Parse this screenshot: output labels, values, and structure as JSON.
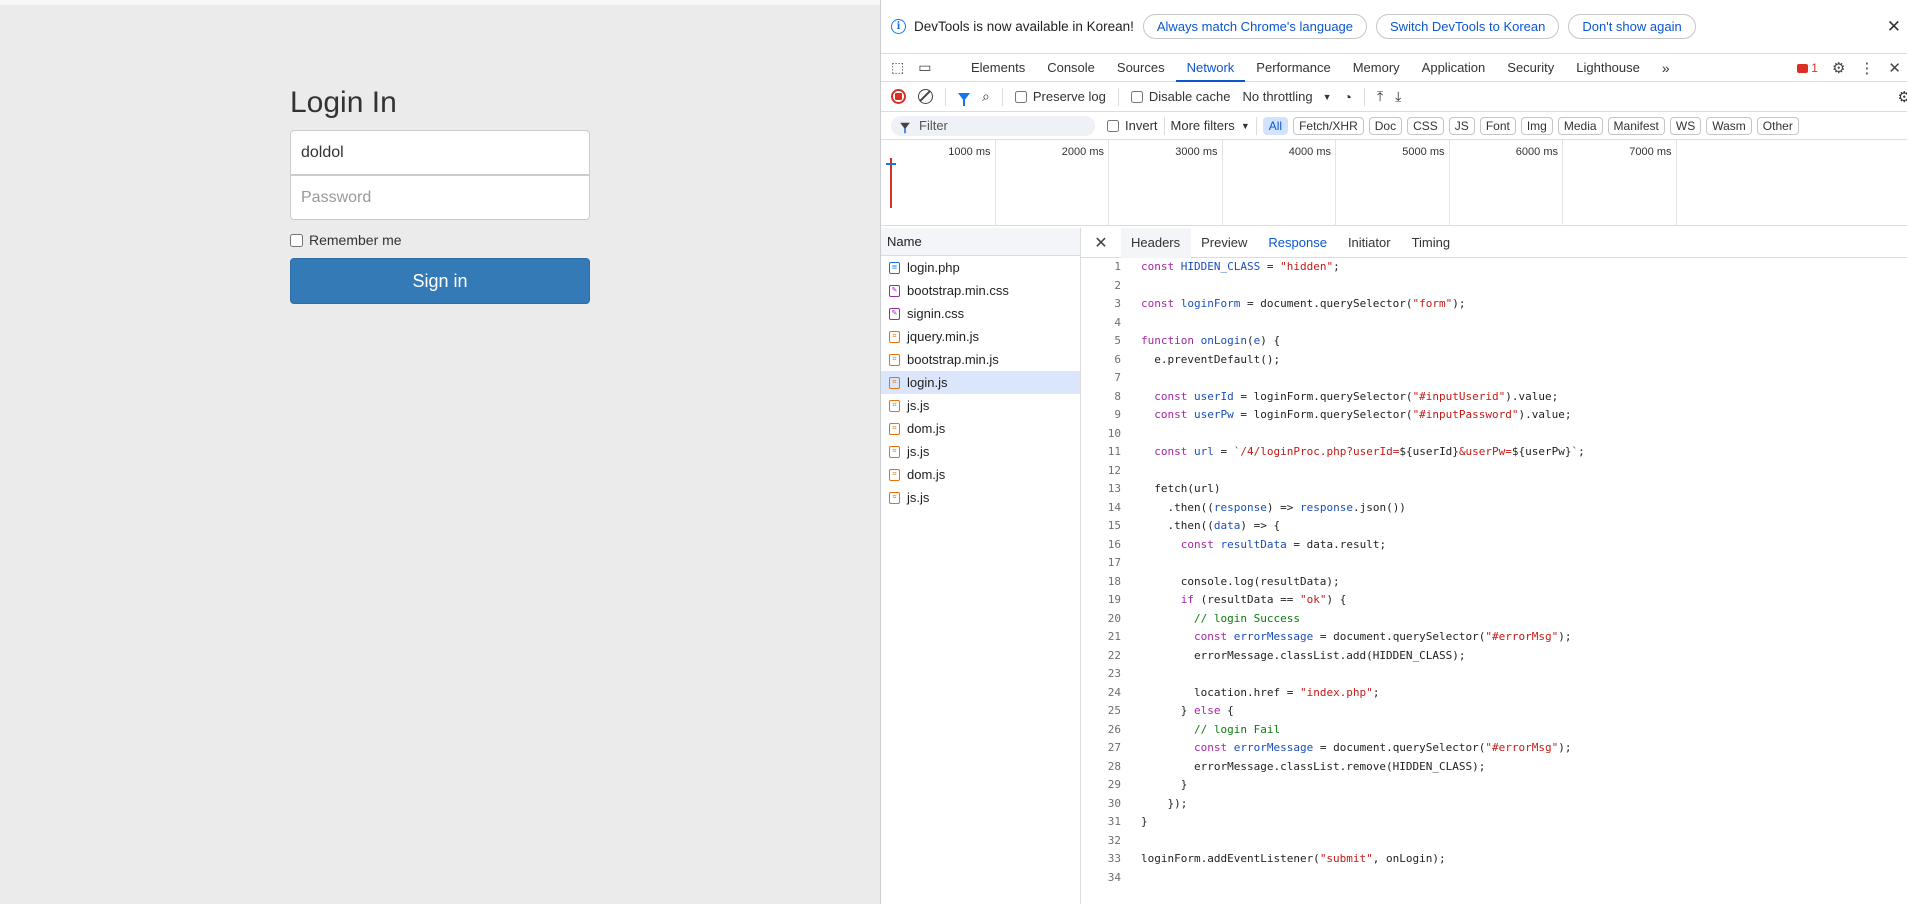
{
  "login": {
    "title": "Login In",
    "username_value": "doldol",
    "password_placeholder": "Password",
    "remember_label": "Remember me",
    "signin_label": "Sign in"
  },
  "infobar": {
    "message": "DevTools is now available in Korean!",
    "btn_match": "Always match Chrome's language",
    "btn_switch": "Switch DevTools to Korean",
    "btn_dont": "Don't show again"
  },
  "tabs": [
    "Elements",
    "Console",
    "Sources",
    "Network",
    "Performance",
    "Memory",
    "Application",
    "Security",
    "Lighthouse"
  ],
  "active_tab": "Network",
  "error_count": "1",
  "toolbar": {
    "preserve_log": "Preserve log",
    "disable_cache": "Disable cache",
    "throttling": "No throttling"
  },
  "filterbar": {
    "placeholder": "Filter",
    "invert": "Invert",
    "more_filters": "More filters",
    "chips": [
      "All",
      "Fetch/XHR",
      "Doc",
      "CSS",
      "JS",
      "Font",
      "Img",
      "Media",
      "Manifest",
      "WS",
      "Wasm",
      "Other"
    ]
  },
  "timeline": {
    "labels": [
      "1000 ms",
      "2000 ms",
      "3000 ms",
      "4000 ms",
      "5000 ms",
      "6000 ms",
      "7000 ms"
    ]
  },
  "name_header": "Name",
  "files": [
    {
      "name": "login.php",
      "type": "doc"
    },
    {
      "name": "bootstrap.min.css",
      "type": "css"
    },
    {
      "name": "signin.css",
      "type": "css"
    },
    {
      "name": "jquery.min.js",
      "type": "js"
    },
    {
      "name": "bootstrap.min.js",
      "type": "js"
    },
    {
      "name": "login.js",
      "type": "js"
    },
    {
      "name": "js.js",
      "type": "js"
    },
    {
      "name": "dom.js",
      "type": "js"
    },
    {
      "name": "js.js",
      "type": "js"
    },
    {
      "name": "dom.js",
      "type": "js"
    },
    {
      "name": "js.js",
      "type": "js"
    }
  ],
  "selected_file_index": 5,
  "detail_tabs": [
    "Headers",
    "Preview",
    "Response",
    "Initiator",
    "Timing"
  ],
  "active_detail_tab": "Response",
  "code_lines": [
    "const HIDDEN_CLASS = \"hidden\";",
    "",
    "const loginForm = document.querySelector(\"form\");",
    "",
    "function onLogin(e) {",
    "  e.preventDefault();",
    "",
    "  const userId = loginForm.querySelector(\"#inputUserid\").value;",
    "  const userPw = loginForm.querySelector(\"#inputPassword\").value;",
    "",
    "  const url = `/4/loginProc.php?userId=${userId}&userPw=${userPw}`;",
    "",
    "  fetch(url)",
    "    .then((response) => response.json())",
    "    .then((data) => {",
    "      const resultData = data.result;",
    "",
    "      console.log(resultData);",
    "      if (resultData == \"ok\") {",
    "        // login Success",
    "        const errorMessage = document.querySelector(\"#errorMsg\");",
    "        errorMessage.classList.add(HIDDEN_CLASS);",
    "",
    "        location.href = \"index.php\";",
    "      } else {",
    "        // login Fail",
    "        const errorMessage = document.querySelector(\"#errorMsg\");",
    "        errorMessage.classList.remove(HIDDEN_CLASS);",
    "      }",
    "    });",
    "}",
    "",
    "loginForm.addEventListener(\"submit\", onLogin);",
    ""
  ]
}
